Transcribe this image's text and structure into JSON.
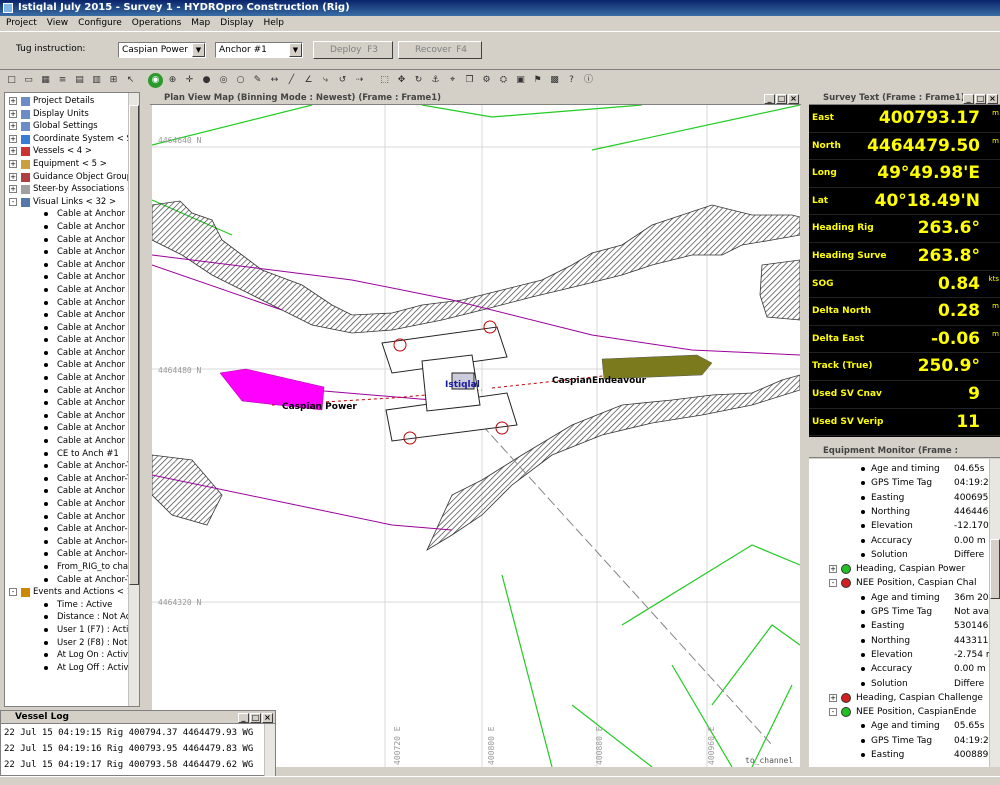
{
  "window": {
    "title": "Istiqlal July 2015 - Survey 1 - HYDROpro Construction (Rig)"
  },
  "menu": [
    "Project",
    "View",
    "Configure",
    "Operations",
    "Map",
    "Display",
    "Help"
  ],
  "tug": {
    "label": "Tug instruction:",
    "vessel_value": "Caspian Power",
    "anchor_value": "Anchor #1",
    "deploy_label": "Deploy",
    "deploy_key": "F3",
    "recover_label": "Recover",
    "recover_key": "F4"
  },
  "toolbar_icons": [
    "new-icon",
    "open-icon",
    "table-icon",
    "list-icon",
    "grid-icon",
    "chart-icon",
    "ruler-icon",
    "cursor-icon",
    "vessel-icon",
    "zoom-icon",
    "crosshair-icon",
    "record-icon",
    "target-icon",
    "circle-icon",
    "pen-icon",
    "measure-icon",
    "line-icon",
    "angle-icon",
    "path-icon",
    "reset-icon",
    "route-icon",
    "select-icon",
    "move-icon",
    "rotate-icon",
    "anchor-icon",
    "pin-icon",
    "layers-icon",
    "config-icon",
    "settings-icon",
    "profile-icon",
    "flag-icon",
    "chart2-icon",
    "help-icon",
    "about-icon"
  ],
  "tree": [
    {
      "label": "Project Details",
      "indent": 0,
      "exp": "+",
      "icon": "doc"
    },
    {
      "label": "Display Units",
      "indent": 0,
      "exp": "+",
      "icon": "doc"
    },
    {
      "label": "Global Settings",
      "indent": 0,
      "exp": "+",
      "icon": "doc"
    },
    {
      "label": "Coordinate System < S",
      "indent": 0,
      "exp": "+",
      "icon": "globe"
    },
    {
      "label": "Vessels < 4 >",
      "indent": 0,
      "exp": "+",
      "icon": "vessel"
    },
    {
      "label": "Equipment < 5 >",
      "indent": 0,
      "exp": "+",
      "icon": "equip"
    },
    {
      "label": "Guidance Object Group",
      "indent": 0,
      "exp": "+",
      "icon": "hatch"
    },
    {
      "label": "Steer-by Associations <",
      "indent": 0,
      "exp": "+",
      "icon": "steer"
    },
    {
      "label": "Visual Links < 32 >",
      "indent": 0,
      "exp": "-",
      "icon": "link"
    },
    {
      "label": "Cable at Anchor #1",
      "indent": 1
    },
    {
      "label": "Cable at Anchor #1",
      "indent": 1
    },
    {
      "label": "Cable at Anchor #1",
      "indent": 1
    },
    {
      "label": "Cable at Anchor #4",
      "indent": 1
    },
    {
      "label": "Cable at Anchor #4",
      "indent": 1
    },
    {
      "label": "Cable at Anchor #4",
      "indent": 1
    },
    {
      "label": "Cable at Anchor #3",
      "indent": 1
    },
    {
      "label": "Cable at Anchor #3",
      "indent": 1
    },
    {
      "label": "Cable at Anchor #5",
      "indent": 1
    },
    {
      "label": "Cable at Anchor #5",
      "indent": 1
    },
    {
      "label": "Cable at Anchor #7",
      "indent": 1
    },
    {
      "label": "Cable at Anchor #7",
      "indent": 1
    },
    {
      "label": "Cable at Anchor #8",
      "indent": 1
    },
    {
      "label": "Cable at Anchor #8",
      "indent": 1
    },
    {
      "label": "Cable at Anchor #2",
      "indent": 1
    },
    {
      "label": "Cable at Anchor #2",
      "indent": 1
    },
    {
      "label": "Cable at Anchor #2",
      "indent": 1
    },
    {
      "label": "Cable at Anchor #6",
      "indent": 1
    },
    {
      "label": "Cable at Anchor #6",
      "indent": 1
    },
    {
      "label": "CE to Anch #1",
      "indent": 1
    },
    {
      "label": "Cable at Anchor-Te",
      "indent": 1
    },
    {
      "label": "Cable at Anchor-Te",
      "indent": 1
    },
    {
      "label": "Cable at Anchor #8",
      "indent": 1
    },
    {
      "label": "Cable at Anchor #4",
      "indent": 1
    },
    {
      "label": "Cable at Anchor #5",
      "indent": 1
    },
    {
      "label": "Cable at Anchor-St",
      "indent": 1
    },
    {
      "label": "Cable at Anchor-St",
      "indent": 1
    },
    {
      "label": "Cable at Anchor-St",
      "indent": 1
    },
    {
      "label": "From_RIG_to chan",
      "indent": 1
    },
    {
      "label": "Cable at Anchor-Te",
      "indent": 1
    },
    {
      "label": "Events and Actions < 1",
      "indent": 0,
      "exp": "-",
      "icon": "events"
    },
    {
      "label": "Time : Active",
      "indent": 1
    },
    {
      "label": "Distance : Not Acti",
      "indent": 1
    },
    {
      "label": "User 1 (F7) : Active",
      "indent": 1
    },
    {
      "label": "User 2 (F8) : Not A",
      "indent": 1
    },
    {
      "label": "At Log On : Active",
      "indent": 1
    },
    {
      "label": "At Log Off : Active",
      "indent": 1
    }
  ],
  "map": {
    "title": "Plan View Map (Binning Mode : Newest)  (Frame : Frame1)",
    "north_labels": [
      "4464640 N",
      "4464480 N",
      "4464320 N"
    ],
    "east_labels": [
      "400720 E",
      "400800 E",
      "400880 E",
      "400960 E"
    ],
    "vessel_labels": [
      "Caspian Power",
      "Istiqlal",
      "CaspianEndeavour"
    ],
    "channel_label": "to_channel",
    "colors": {
      "caspian_power": "#ff00ff",
      "caspian_endeavour": "#7b7b1e",
      "contour": "#22cc22",
      "route": "#9b009b"
    }
  },
  "survey": {
    "title": "Survey Text (Frame : Frame1)",
    "rows": [
      {
        "label": "East",
        "value": "400793.17",
        "unit": "m"
      },
      {
        "label": "North",
        "value": "4464479.50",
        "unit": "m"
      },
      {
        "label": "Long",
        "value": "49°49.98'E",
        "unit": ""
      },
      {
        "label": "Lat",
        "value": "40°18.49'N",
        "unit": ""
      },
      {
        "label": "Heading Rig",
        "value": "263.6°",
        "unit": ""
      },
      {
        "label": "Heading Surve",
        "value": "263.8°",
        "unit": ""
      },
      {
        "label": "SOG",
        "value": "0.84",
        "unit": "kts"
      },
      {
        "label": "Delta North",
        "value": "0.28",
        "unit": "m"
      },
      {
        "label": "Delta East",
        "value": "-0.06",
        "unit": "m"
      },
      {
        "label": "Track (True)",
        "value": "250.9°",
        "unit": ""
      },
      {
        "label": "Used SV Cnav",
        "value": "9",
        "unit": ""
      },
      {
        "label": "Used SV Verip",
        "value": "11",
        "unit": ""
      }
    ]
  },
  "equipment": {
    "title": "Equipment Monitor (Frame : ",
    "rows": [
      {
        "label": "Age and timing",
        "value": "04.65s",
        "level": 2
      },
      {
        "label": "GPS Time Tag",
        "value": "04:19:2",
        "level": 2
      },
      {
        "label": "Easting",
        "value": "400695",
        "level": 2
      },
      {
        "label": "Northing",
        "value": "446446",
        "level": 2
      },
      {
        "label": "Elevation",
        "value": "-12.170",
        "level": 2
      },
      {
        "label": "Accuracy",
        "value": "0.00 m",
        "level": 2
      },
      {
        "label": "Solution",
        "value": "Differe",
        "level": 2
      },
      {
        "label": "Heading, Caspian Power",
        "value": "",
        "level": 1,
        "status": "green",
        "exp": "+"
      },
      {
        "label": "NEE Position, Caspian Chal",
        "value": "",
        "level": 1,
        "status": "red",
        "exp": "-"
      },
      {
        "label": "Age and timing",
        "value": "36m 20",
        "level": 2
      },
      {
        "label": "GPS Time Tag",
        "value": "Not ava",
        "level": 2
      },
      {
        "label": "Easting",
        "value": "530146",
        "level": 2
      },
      {
        "label": "Northing",
        "value": "443311",
        "level": 2
      },
      {
        "label": "Elevation",
        "value": "-2.754 m",
        "level": 2
      },
      {
        "label": "Accuracy",
        "value": "0.00 m",
        "level": 2
      },
      {
        "label": "Solution",
        "value": "Differe",
        "level": 2
      },
      {
        "label": "Heading, Caspian Challenge",
        "value": "",
        "level": 1,
        "status": "red",
        "exp": "+"
      },
      {
        "label": "NEE Position, CaspianEnde",
        "value": "",
        "level": 1,
        "status": "green",
        "exp": "-"
      },
      {
        "label": "Age and timing",
        "value": "05.65s",
        "level": 2
      },
      {
        "label": "GPS Time Tag",
        "value": "04:19:2",
        "level": 2
      },
      {
        "label": "Easting",
        "value": "400889",
        "level": 2
      }
    ]
  },
  "vessel_log": {
    "title": "Vessel Log",
    "lines": [
      "22 Jul 15 04:19:15 Rig 400794.37 4464479.93 WG",
      "22 Jul 15 04:19:16 Rig 400793.95 4464479.83 WG",
      "22 Jul 15 04:19:17 Rig 400793.58 4464479.62 WG"
    ]
  }
}
